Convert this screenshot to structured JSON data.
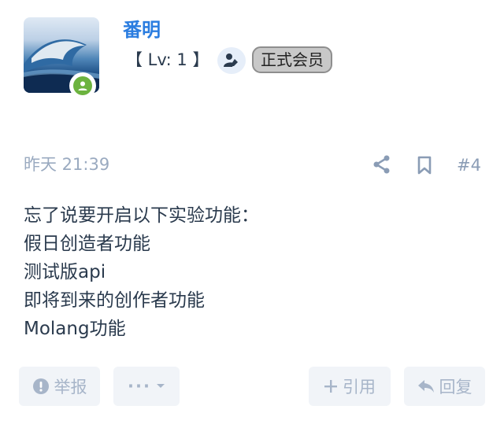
{
  "user": {
    "name": "番明",
    "level_text": "【 Lv: 1 】",
    "member_badge": "正式会员",
    "avatar_icon": "wave-photo-avatar",
    "online_icon": "user-online-icon",
    "edit_icon": "user-edit-icon"
  },
  "post": {
    "time": "昨天 21:39",
    "number": "#4",
    "lines": [
      "忘了说要开启以下实验功能：",
      "假日创造者功能",
      "测试版api",
      "即将到来的创作者功能",
      "Molang功能"
    ]
  },
  "actions": {
    "report_label": "举报",
    "more_label": "···",
    "quote_label": "引用",
    "reply_label": "回复"
  },
  "colors": {
    "username": "#2b7de0",
    "online": "#6cb33f",
    "muted": "#9aaac0",
    "button_bg": "#f1f4f8"
  }
}
